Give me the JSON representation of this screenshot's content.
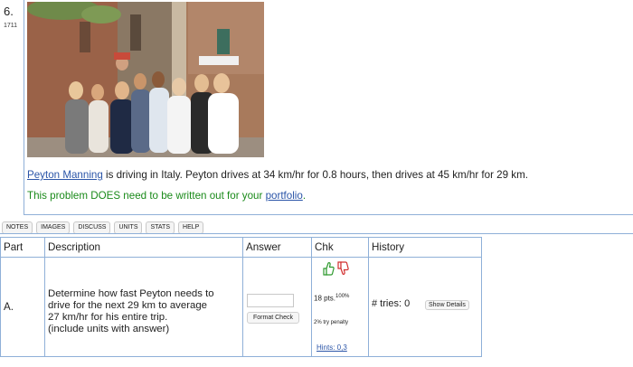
{
  "question": {
    "number": "6.",
    "id": "1711",
    "text_name_link": "Peyton Manning",
    "text_rest": " is driving in Italy. Peyton drives at 34 km/hr for 0.8 hours, then drives at 45 km/hr for 29 km.",
    "note_prefix": "This problem DOES need to be written out for your ",
    "note_link": "portfolio",
    "note_suffix": "."
  },
  "tabs": [
    "NOTES",
    "IMAGES",
    "DISCUSS",
    "UNITS",
    "STATS",
    "HELP"
  ],
  "table": {
    "headers": {
      "part": "Part",
      "description": "Description",
      "answer": "Answer",
      "chk": "Chk",
      "history": "History"
    },
    "row": {
      "part": "A.",
      "description": [
        "Determine how fast Peyton needs to",
        "drive for the next 29 km to average",
        "27 km/hr for his entire trip.",
        "(include units with answer)"
      ],
      "answer_value": "",
      "format_check_label": "Format Check",
      "points": "18 pts.",
      "points_pct": "100%",
      "penalty": "2% try penalty",
      "hints": "Hints: 0,3",
      "tries_text": "# tries: 0",
      "details_label": "Show Details"
    }
  },
  "colors": {
    "link": "#2b55a8",
    "note_green": "#1a8a1a",
    "border_blue": "#8fb0d8"
  }
}
